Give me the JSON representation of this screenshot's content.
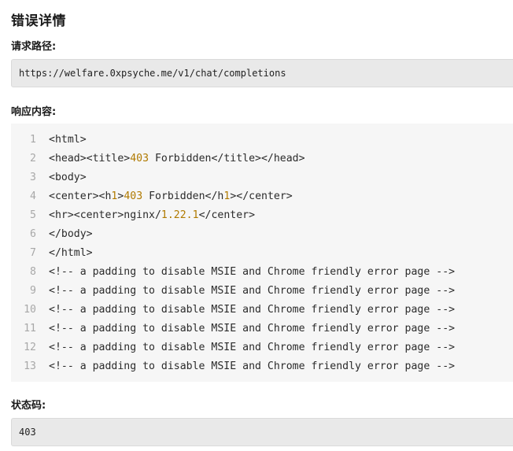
{
  "title": "错误详情",
  "request": {
    "label": "请求路径:",
    "url": "https://welfare.0xpsyche.me/v1/chat/completions"
  },
  "response": {
    "label": "响应内容:",
    "lines": [
      {
        "no": "1",
        "parts": [
          {
            "t": "<html>"
          }
        ]
      },
      {
        "no": "2",
        "parts": [
          {
            "t": "<head><title>"
          },
          {
            "t": "403",
            "n": true
          },
          {
            "t": " Forbidden</title></head>"
          }
        ]
      },
      {
        "no": "3",
        "parts": [
          {
            "t": "<body>"
          }
        ]
      },
      {
        "no": "4",
        "parts": [
          {
            "t": "<center><h"
          },
          {
            "t": "1",
            "n": true
          },
          {
            "t": ">"
          },
          {
            "t": "403",
            "n": true
          },
          {
            "t": " Forbidden</h"
          },
          {
            "t": "1",
            "n": true
          },
          {
            "t": "></center>"
          }
        ]
      },
      {
        "no": "5",
        "parts": [
          {
            "t": "<hr><center>nginx/"
          },
          {
            "t": "1.22.1",
            "n": true
          },
          {
            "t": "</center>"
          }
        ]
      },
      {
        "no": "6",
        "parts": [
          {
            "t": "</body>"
          }
        ]
      },
      {
        "no": "7",
        "parts": [
          {
            "t": "</html>"
          }
        ]
      },
      {
        "no": "8",
        "parts": [
          {
            "t": "<!-- a padding to disable MSIE and Chrome friendly error page -->"
          }
        ]
      },
      {
        "no": "9",
        "parts": [
          {
            "t": "<!-- a padding to disable MSIE and Chrome friendly error page -->"
          }
        ]
      },
      {
        "no": "10",
        "parts": [
          {
            "t": "<!-- a padding to disable MSIE and Chrome friendly error page -->"
          }
        ]
      },
      {
        "no": "11",
        "parts": [
          {
            "t": "<!-- a padding to disable MSIE and Chrome friendly error page -->"
          }
        ]
      },
      {
        "no": "12",
        "parts": [
          {
            "t": "<!-- a padding to disable MSIE and Chrome friendly error page -->"
          }
        ]
      },
      {
        "no": "13",
        "parts": [
          {
            "t": "<!-- a padding to disable MSIE and Chrome friendly error page -->"
          }
        ]
      }
    ]
  },
  "status": {
    "label": "状态码:",
    "code": "403"
  },
  "colors": {
    "number_highlight": "#b07a00",
    "field_bg": "#e9e9e9",
    "code_bg": "#f6f6f6"
  }
}
